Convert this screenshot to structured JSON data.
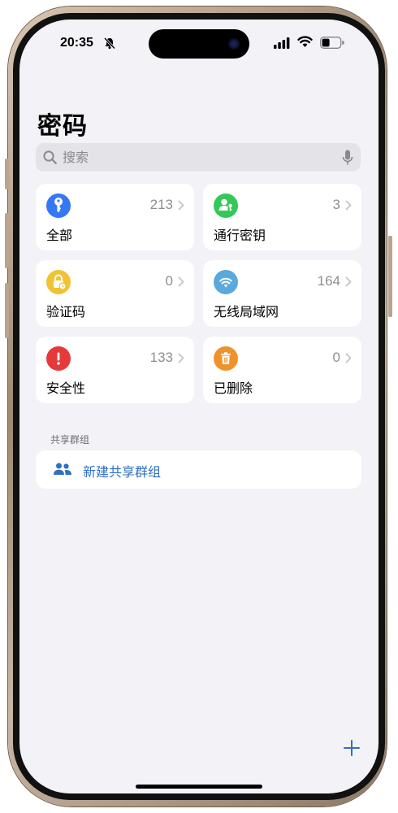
{
  "status_bar": {
    "time": "20:35"
  },
  "header": {
    "title": "密码"
  },
  "search": {
    "placeholder": "搜索"
  },
  "categories": [
    {
      "label": "全部",
      "count": "213",
      "icon": "key-icon",
      "color": "#3478f6"
    },
    {
      "label": "通行密钥",
      "count": "3",
      "icon": "person-key-icon",
      "color": "#34c759"
    },
    {
      "label": "验证码",
      "count": "0",
      "icon": "lock-clock-icon",
      "color": "#f2c233"
    },
    {
      "label": "无线局域网",
      "count": "164",
      "icon": "wifi-icon",
      "color": "#5aa9dc"
    },
    {
      "label": "安全性",
      "count": "133",
      "icon": "exclamation-icon",
      "color": "#e5393a"
    },
    {
      "label": "已删除",
      "count": "0",
      "icon": "trash-icon",
      "color": "#f0922a"
    }
  ],
  "shared_groups": {
    "header": "共享群组",
    "new_group_label": "新建共享群组"
  },
  "colors": {
    "accent": "#2f6fc1",
    "background": "#f2f2f7"
  }
}
